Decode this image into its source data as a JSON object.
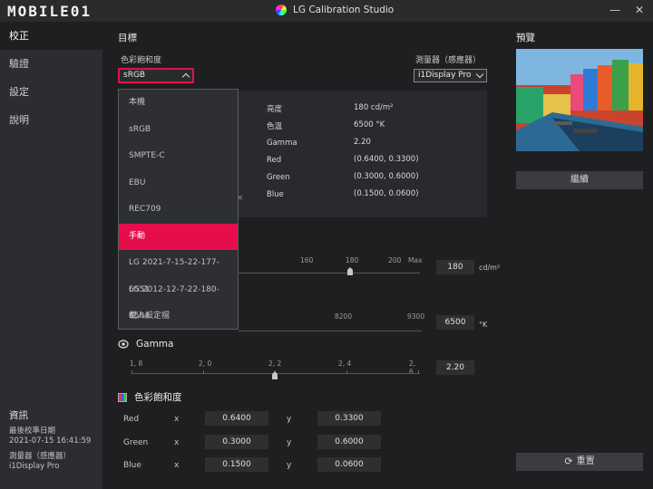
{
  "window": {
    "logo_text": "MOBILE01",
    "app_title": "LG Calibration Studio",
    "minimize": "—",
    "close": "✕"
  },
  "sidebar": {
    "items": [
      {
        "label": "校正",
        "active": true
      },
      {
        "label": "驗證",
        "active": false
      },
      {
        "label": "設定",
        "active": false
      },
      {
        "label": "說明",
        "active": false
      }
    ],
    "info": {
      "title": "資訊",
      "last_cal_label": "最後校準日期",
      "last_cal_value": "2021-07-15 16:41:59",
      "meter_label": "測量器（感應器）",
      "meter_value": "i1Display Pro"
    }
  },
  "target": {
    "title": "目標",
    "gamut_label": "色彩飽和度",
    "gamut_value": "sRGB",
    "meter_label": "測量器（感應器）",
    "meter_value": "i1Display Pro",
    "specs": [
      {
        "key": "亮度",
        "value": "180 cd/m²"
      },
      {
        "key": "色溫",
        "value": "6500 °K"
      },
      {
        "key": "Gamma",
        "value": "2.20"
      },
      {
        "key": "Red",
        "value": "(0.6400, 0.3300)"
      },
      {
        "key": "Green",
        "value": "(0.3000, 0.6000)"
      },
      {
        "key": "Blue",
        "value": "(0.1500, 0.0600)"
      }
    ],
    "partial_x": "×"
  },
  "dropdown": {
    "options": [
      "本機",
      "sRGB",
      "SMPTE-C",
      "EBU",
      "REC709",
      "手動",
      "LG 2021-7-15-22-177-6551",
      "LG 2012-12-7-22-180-6504",
      "載入設定檔"
    ],
    "selected": "手動"
  },
  "brightness": {
    "ticks": [
      "160",
      "180",
      "200",
      "Max"
    ],
    "value": "180",
    "unit": "cd/m²",
    "level": 180
  },
  "color_temp": {
    "ticks": [
      "8200",
      "9300"
    ],
    "value": "6500",
    "unit": "°K"
  },
  "gamma": {
    "title": "Gamma",
    "ticks": [
      "1, 8",
      "2, 0",
      "2, 2",
      "2, 4",
      "2, 6"
    ],
    "value": "2.20",
    "level": 2.2
  },
  "gamut_section": {
    "title": "色彩飽和度",
    "x_label": "x",
    "y_label": "y",
    "rows": [
      {
        "name": "Red",
        "x": "0.6400",
        "y": "0.3300"
      },
      {
        "name": "Green",
        "x": "0.3000",
        "y": "0.6000"
      },
      {
        "name": "Blue",
        "x": "0.1500",
        "y": "0.0600"
      }
    ]
  },
  "right": {
    "preview_label": "預覽",
    "continue_label": "繼續",
    "reset_label": "重置"
  }
}
